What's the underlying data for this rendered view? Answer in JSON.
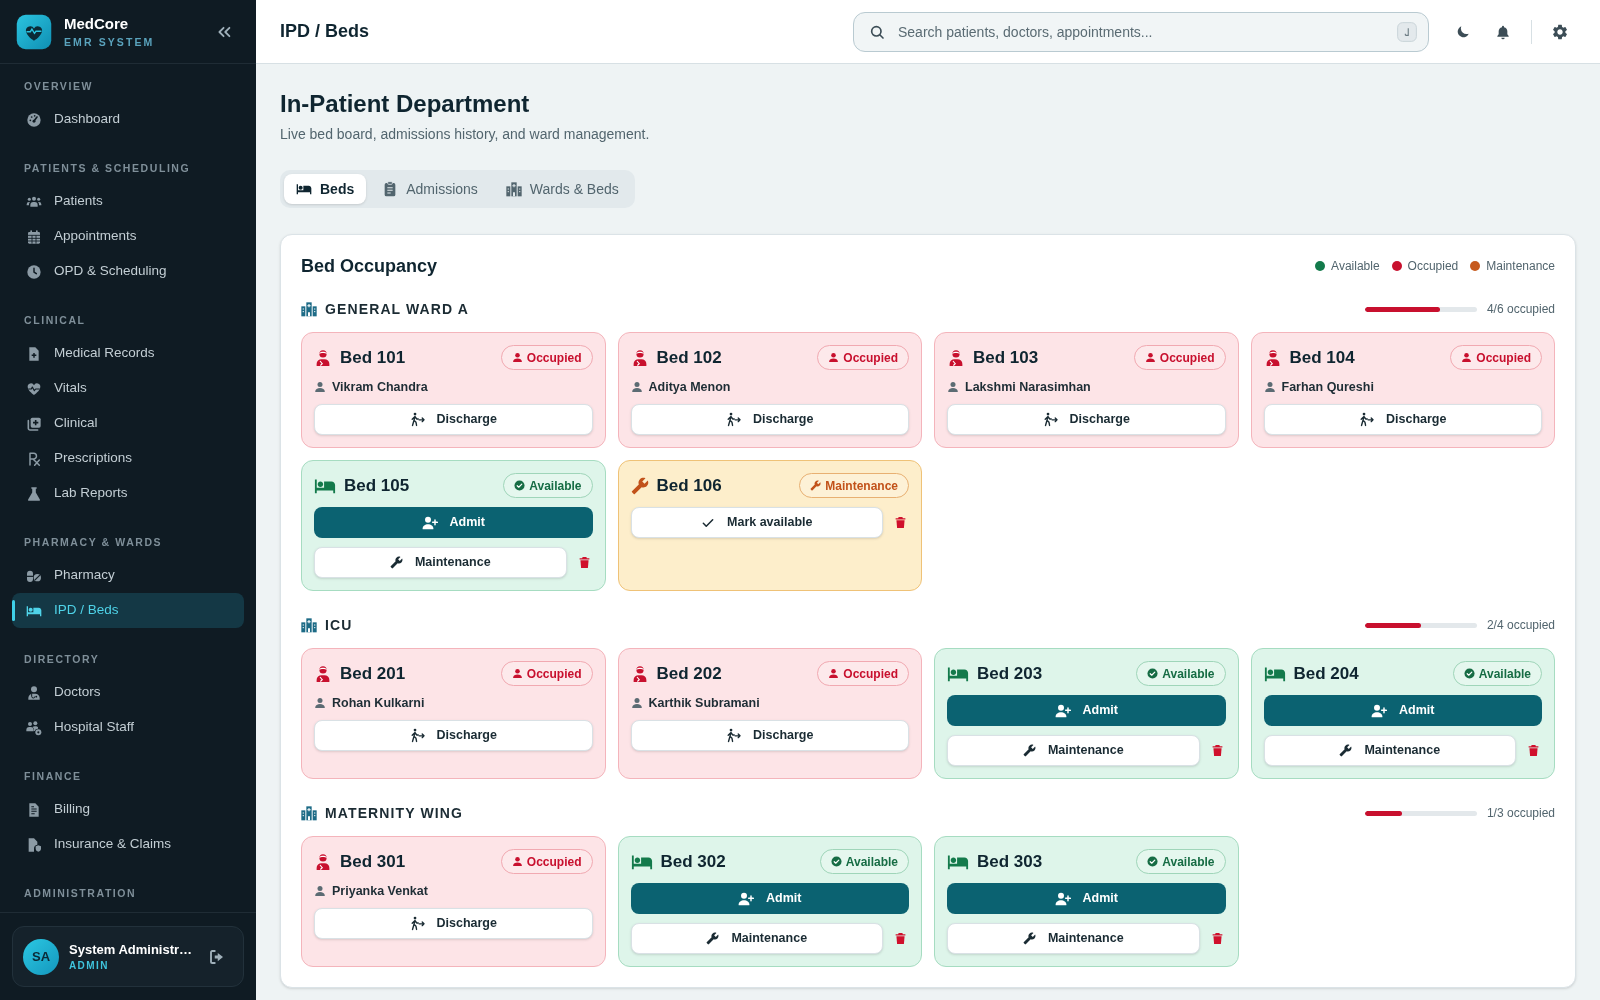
{
  "sidebar": {
    "brand": {
      "name": "MedCore",
      "tagline": "EMR SYSTEM"
    },
    "sections": [
      {
        "label": "OVERVIEW",
        "items": [
          {
            "label": "Dashboard",
            "selected": false
          }
        ]
      },
      {
        "label": "PATIENTS & SCHEDULING",
        "items": [
          {
            "label": "Patients",
            "selected": false
          },
          {
            "label": "Appointments",
            "selected": false
          },
          {
            "label": "OPD & Scheduling",
            "selected": false
          }
        ]
      },
      {
        "label": "CLINICAL",
        "items": [
          {
            "label": "Medical Records",
            "selected": false
          },
          {
            "label": "Vitals",
            "selected": false
          },
          {
            "label": "Clinical",
            "selected": false
          },
          {
            "label": "Prescriptions",
            "selected": false
          },
          {
            "label": "Lab Reports",
            "selected": false
          }
        ]
      },
      {
        "label": "PHARMACY & WARDS",
        "items": [
          {
            "label": "Pharmacy",
            "selected": false
          },
          {
            "label": "IPD / Beds",
            "selected": true
          }
        ]
      },
      {
        "label": "DIRECTORY",
        "items": [
          {
            "label": "Doctors",
            "selected": false
          },
          {
            "label": "Hospital Staff",
            "selected": false
          }
        ]
      },
      {
        "label": "FINANCE",
        "items": [
          {
            "label": "Billing",
            "selected": false
          },
          {
            "label": "Insurance & Claims",
            "selected": false
          }
        ]
      },
      {
        "label": "ADMINISTRATION"
      }
    ],
    "user": {
      "initials": "SA",
      "name": "System Administr…",
      "role": "ADMIN"
    }
  },
  "header": {
    "title": "IPD / Beds",
    "search": {
      "placeholder": "Search patients, doctors, appointments..."
    }
  },
  "page": {
    "title": "In-Patient Department",
    "subtitle": "Live bed board, admissions history, and ward management.",
    "tabs": [
      {
        "label": "Beds",
        "selected": true
      },
      {
        "label": "Admissions",
        "selected": false
      },
      {
        "label": "Wards & Beds",
        "selected": false
      }
    ]
  },
  "occupancy": {
    "title": "Bed Occupancy",
    "legend": [
      {
        "label": "Available",
        "color": "#137a4b"
      },
      {
        "label": "Occupied",
        "color": "#c8102e"
      },
      {
        "label": "Maintenance",
        "color": "#c65a1e"
      }
    ],
    "wards": [
      {
        "name": "GENERAL WARD A",
        "occupancy": "4/6 occupied",
        "level": 0.667,
        "beds": [
          {
            "name": "Bed 101",
            "kind": "occupied",
            "badge": "Occupied",
            "patient": "Vikram Chandra",
            "actions": [
              {
                "kind": "discharge",
                "label": "Discharge"
              }
            ]
          },
          {
            "name": "Bed 102",
            "kind": "occupied",
            "badge": "Occupied",
            "patient": "Aditya Menon",
            "actions": [
              {
                "kind": "discharge",
                "label": "Discharge"
              }
            ]
          },
          {
            "name": "Bed 103",
            "kind": "occupied",
            "badge": "Occupied",
            "patient": "Lakshmi Narasimhan",
            "actions": [
              {
                "kind": "discharge",
                "label": "Discharge"
              }
            ]
          },
          {
            "name": "Bed 104",
            "kind": "occupied",
            "badge": "Occupied",
            "patient": "Farhan Qureshi",
            "actions": [
              {
                "kind": "discharge",
                "label": "Discharge"
              }
            ]
          },
          {
            "name": "Bed 105",
            "kind": "available",
            "badge": "Available",
            "actions": [
              {
                "kind": "admit",
                "label": "Admit"
              },
              {
                "kind": "maintenance",
                "label": "Maintenance"
              },
              {
                "kind": "delete"
              }
            ]
          },
          {
            "name": "Bed 106",
            "kind": "maintenance",
            "badge": "Maintenance",
            "actions": [
              {
                "kind": "mark_available",
                "label": "Mark available"
              },
              {
                "kind": "delete"
              }
            ]
          }
        ]
      },
      {
        "name": "ICU",
        "occupancy": "2/4 occupied",
        "level": 0.5,
        "beds": [
          {
            "name": "Bed 201",
            "kind": "occupied",
            "badge": "Occupied",
            "patient": "Rohan Kulkarni",
            "actions": [
              {
                "kind": "discharge",
                "label": "Discharge"
              }
            ]
          },
          {
            "name": "Bed 202",
            "kind": "occupied",
            "badge": "Occupied",
            "patient": "Karthik Subramani",
            "actions": [
              {
                "kind": "discharge",
                "label": "Discharge"
              }
            ]
          },
          {
            "name": "Bed 203",
            "kind": "available",
            "badge": "Available",
            "actions": [
              {
                "kind": "admit",
                "label": "Admit"
              },
              {
                "kind": "maintenance",
                "label": "Maintenance"
              },
              {
                "kind": "delete"
              }
            ]
          },
          {
            "name": "Bed 204",
            "kind": "available",
            "badge": "Available",
            "actions": [
              {
                "kind": "admit",
                "label": "Admit"
              },
              {
                "kind": "maintenance",
                "label": "Maintenance"
              },
              {
                "kind": "delete"
              }
            ]
          }
        ]
      },
      {
        "name": "MATERNITY WING",
        "occupancy": "1/3 occupied",
        "level": 0.333,
        "beds": [
          {
            "name": "Bed 301",
            "kind": "occupied",
            "badge": "Occupied",
            "patient": "Priyanka Venkat",
            "actions": [
              {
                "kind": "discharge",
                "label": "Discharge"
              }
            ]
          },
          {
            "name": "Bed 302",
            "kind": "available",
            "badge": "Available",
            "actions": [
              {
                "kind": "admit",
                "label": "Admit"
              },
              {
                "kind": "maintenance",
                "label": "Maintenance"
              },
              {
                "kind": "delete"
              }
            ]
          },
          {
            "name": "Bed 303",
            "kind": "available",
            "badge": "Available",
            "actions": [
              {
                "kind": "admit",
                "label": "Admit"
              },
              {
                "kind": "maintenance",
                "label": "Maintenance"
              },
              {
                "kind": "delete"
              }
            ]
          }
        ]
      }
    ]
  }
}
